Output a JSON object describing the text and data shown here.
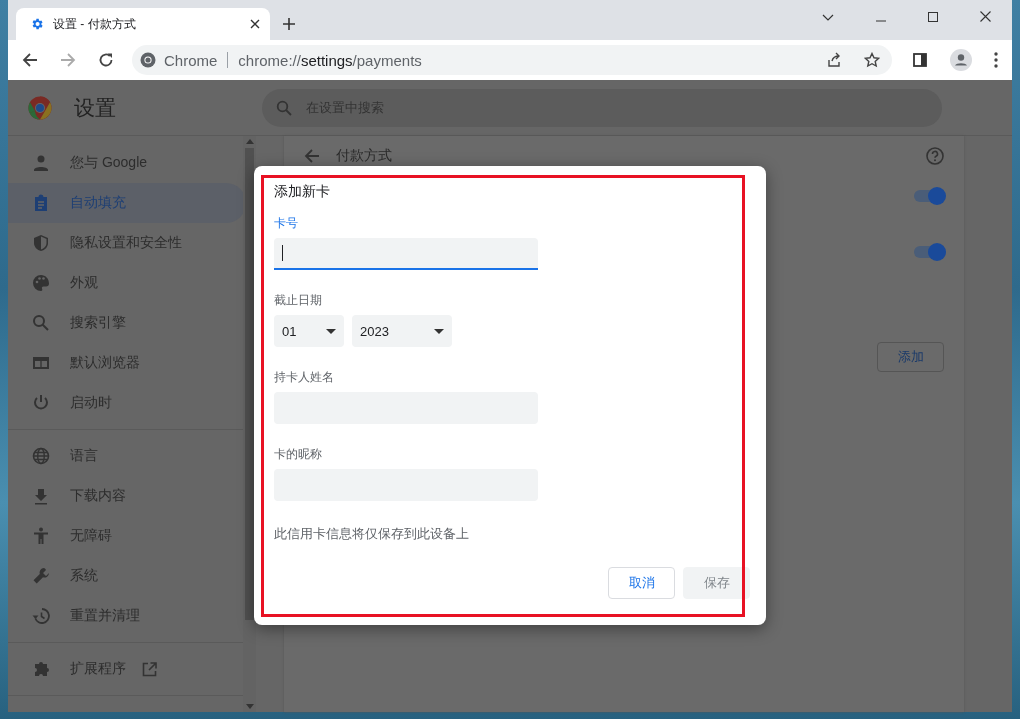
{
  "browser": {
    "tabs": [
      {
        "title": "设置 - 付款方式",
        "selected": true
      }
    ],
    "address_bar": {
      "site_label": "Chrome",
      "url": "chrome://**settings**/payments"
    }
  },
  "settings_header": {
    "title": "设置",
    "search": {
      "placeholder": "在设置中搜索"
    }
  },
  "sidebar": {
    "groups": [
      [
        {
          "label": "您与 Google",
          "selected": false
        },
        {
          "label": "自动填充",
          "selected": true
        },
        {
          "label": "隐私设置和安全性",
          "selected": false
        },
        {
          "label": "外观",
          "selected": false
        },
        {
          "label": "搜索引擎",
          "selected": false
        },
        {
          "label": "默认浏览器",
          "selected": false
        },
        {
          "label": "启动时",
          "selected": false
        }
      ],
      [
        {
          "label": "语言",
          "selected": false
        },
        {
          "label": "下载内容",
          "selected": false
        },
        {
          "label": "无障碍",
          "selected": false
        },
        {
          "label": "系统",
          "selected": false
        },
        {
          "label": "重置并清理",
          "selected": false
        }
      ],
      [
        {
          "label": "扩展程序",
          "selected": false,
          "external": true
        }
      ]
    ]
  },
  "page": {
    "title": "付款方式",
    "toggles": [
      {
        "on": true
      },
      {
        "on": true
      }
    ],
    "add_button": "添加"
  },
  "dialog": {
    "title": "添加新卡",
    "fields": [
      {
        "kind": "text",
        "label": "卡号",
        "focused": true
      },
      {
        "kind": "expiry",
        "label": "截止日期",
        "month": "01",
        "year": "2023"
      },
      {
        "kind": "text",
        "label": "持卡人姓名",
        "focused": false
      },
      {
        "kind": "text",
        "label": "卡的昵称",
        "focused": false
      }
    ],
    "note": "此信用卡信息将仅保存到此设备上",
    "buttons": [
      {
        "label": "取消",
        "kind": "cancel",
        "disabled": false
      },
      {
        "label": "保存",
        "kind": "save",
        "disabled": true
      }
    ]
  },
  "highlight": {
    "visible": true
  }
}
